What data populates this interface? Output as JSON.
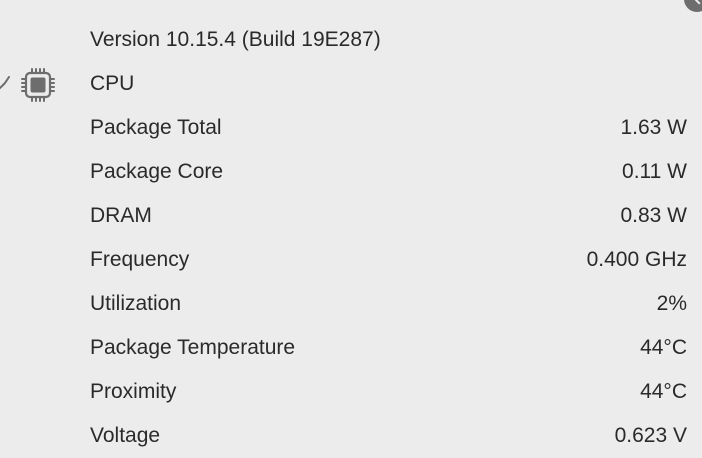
{
  "version_text": "Version 10.15.4 (Build 19E287)",
  "cpu": {
    "label": "CPU",
    "icon": "cpu-chip-icon",
    "expanded": true
  },
  "metrics": [
    {
      "label": "Package Total",
      "value": "1.63 W"
    },
    {
      "label": "Package Core",
      "value": "0.11 W"
    },
    {
      "label": "DRAM",
      "value": "0.83 W"
    },
    {
      "label": "Frequency",
      "value": "0.400 GHz"
    },
    {
      "label": "Utilization",
      "value": "2%"
    },
    {
      "label": "Package Temperature",
      "value": "44°C"
    },
    {
      "label": "Proximity",
      "value": "44°C"
    },
    {
      "label": "Voltage",
      "value": "0.623 V"
    }
  ],
  "colors": {
    "background": "#ececec",
    "text": "#2a2a2a",
    "icon": "#6d6d6d"
  }
}
